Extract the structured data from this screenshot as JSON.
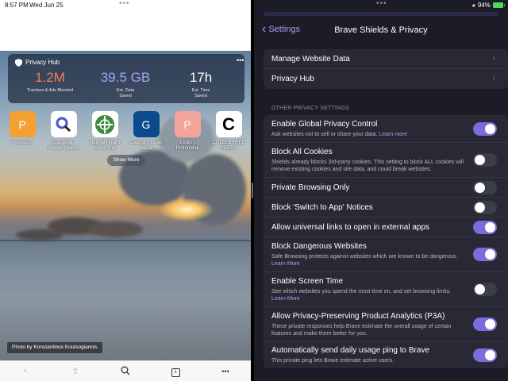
{
  "left": {
    "status": {
      "time": "8:57 PM",
      "date": "Wed Jun 25",
      "dots": "•••"
    },
    "privacy_hub": {
      "title": "Privacy Hub",
      "more": "•••",
      "stats": [
        {
          "value": "1.2M",
          "label": "Trackers & Ads Blocked",
          "color": "#f57a52"
        },
        {
          "value": "39.5 GB",
          "label": "Est. Data\nSaved",
          "color": "#a6a3f5"
        },
        {
          "value": "17h",
          "label": "Est. Time\nSaved",
          "color": "#ffffff"
        }
      ]
    },
    "favorites": [
      {
        "letter": "P",
        "name": "Presearch",
        "color": "#f5a030",
        "icon": "letter-p"
      },
      {
        "letter": "Q",
        "name": "Startpage - Private Search",
        "color": "#ffffff",
        "icon": "magnifier-logo"
      },
      {
        "letter": "",
        "name": "Natural Health News and",
        "color": "#ffffff",
        "icon": "globe-logo"
      },
      {
        "letter": "G",
        "name": "Gab.com / Gab Social",
        "color": "#0b4a8c",
        "icon": "letter-g"
      },
      {
        "letter": "P",
        "name": "Login | ProtonMail",
        "color": "#f5a49a",
        "icon": "letter-p"
      },
      {
        "letter": "C",
        "name": "CITIZEN FREE PRESS",
        "color": "#ffffff",
        "icon": "letter-c"
      }
    ],
    "show_more": "Show More",
    "photo_credit": "Photo by Konstantinos Koutsogiannis",
    "toolbar": {
      "tabs_count": "1",
      "more": "•••"
    }
  },
  "right": {
    "status": {
      "battery": "94%",
      "dots": "•••"
    },
    "nav": {
      "back_label": "Settings",
      "title": "Brave Shields & Privacy"
    },
    "top_rows": [
      {
        "label": "Manage Website Data"
      },
      {
        "label": "Privacy Hub"
      }
    ],
    "section_title": "OTHER PRIVACY SETTINGS",
    "settings": [
      {
        "label": "Enable Global Privacy Control",
        "desc": "Ask websites not to sell or share your data.",
        "learn": "Learn more",
        "on": true
      },
      {
        "label": "Block All Cookies",
        "desc": "Shields already blocks 3rd-party cookies. This setting to block ALL cookies will remove existing cookies and site data, and could break websites.",
        "learn": "",
        "on": false
      },
      {
        "label": "Private Browsing Only",
        "desc": "",
        "learn": "",
        "on": false
      },
      {
        "label": "Block 'Switch to App' Notices",
        "desc": "",
        "learn": "",
        "on": false
      },
      {
        "label": "Allow universal links to open in external apps",
        "desc": "",
        "learn": "",
        "on": true
      },
      {
        "label": "Block Dangerous Websites",
        "desc": "Safe Browsing protects against websites which are known to be dangerous.",
        "learn": "Learn More",
        "on": true
      },
      {
        "label": "Enable Screen Time",
        "desc": "See which websites you spend the most time on, and set browsing limits.",
        "learn": "Learn More",
        "on": false
      },
      {
        "label": "Allow Privacy-Preserving Product Analytics (P3A)",
        "desc": "These private responses help Brave estimate the overall usage of certain features and make them better for you.",
        "learn": "",
        "on": true
      },
      {
        "label": "Automatically send daily usage ping to Brave",
        "desc": "This private ping lets Brave estimate active users.",
        "learn": "",
        "on": true
      }
    ]
  }
}
